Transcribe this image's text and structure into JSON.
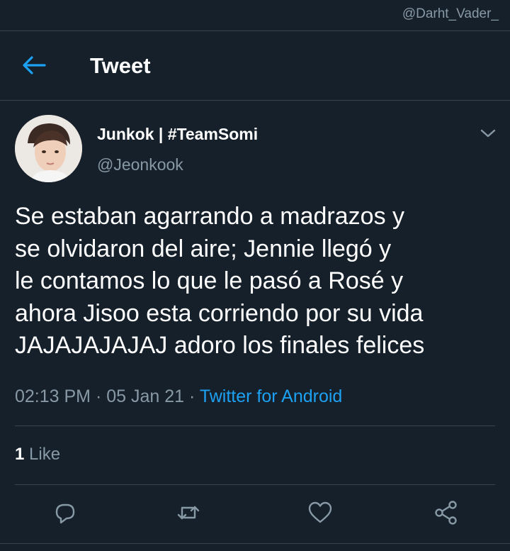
{
  "watermark": "@Darht_Vader_",
  "header": {
    "title": "Tweet",
    "back_icon": "arrow-left-icon"
  },
  "tweet": {
    "display_name": "Junkok | #TeamSomi",
    "handle": "@Jeonkook",
    "text": "Se estaban agarrando a madrazos y\nse olvidaron del aire; Jennie llegó y\nle contamos lo que le pasó a Rosé y\nahora Jisoo esta corriendo por su vida\nJAJAJAJAJAJ adoro los finales felices",
    "time": "02:13 PM",
    "separator_1": "·",
    "date": "05 Jan 21",
    "separator_2": "·",
    "source": "Twitter for Android",
    "likes_count": "1",
    "likes_label": "Like"
  },
  "actions": {
    "reply_icon": "reply-icon",
    "retweet_icon": "retweet-icon",
    "like_icon": "heart-icon",
    "share_icon": "share-icon"
  },
  "colors": {
    "background": "#15202b",
    "accent": "#1da1f2",
    "secondary_text": "#8899a6",
    "divider": "#38444d"
  }
}
